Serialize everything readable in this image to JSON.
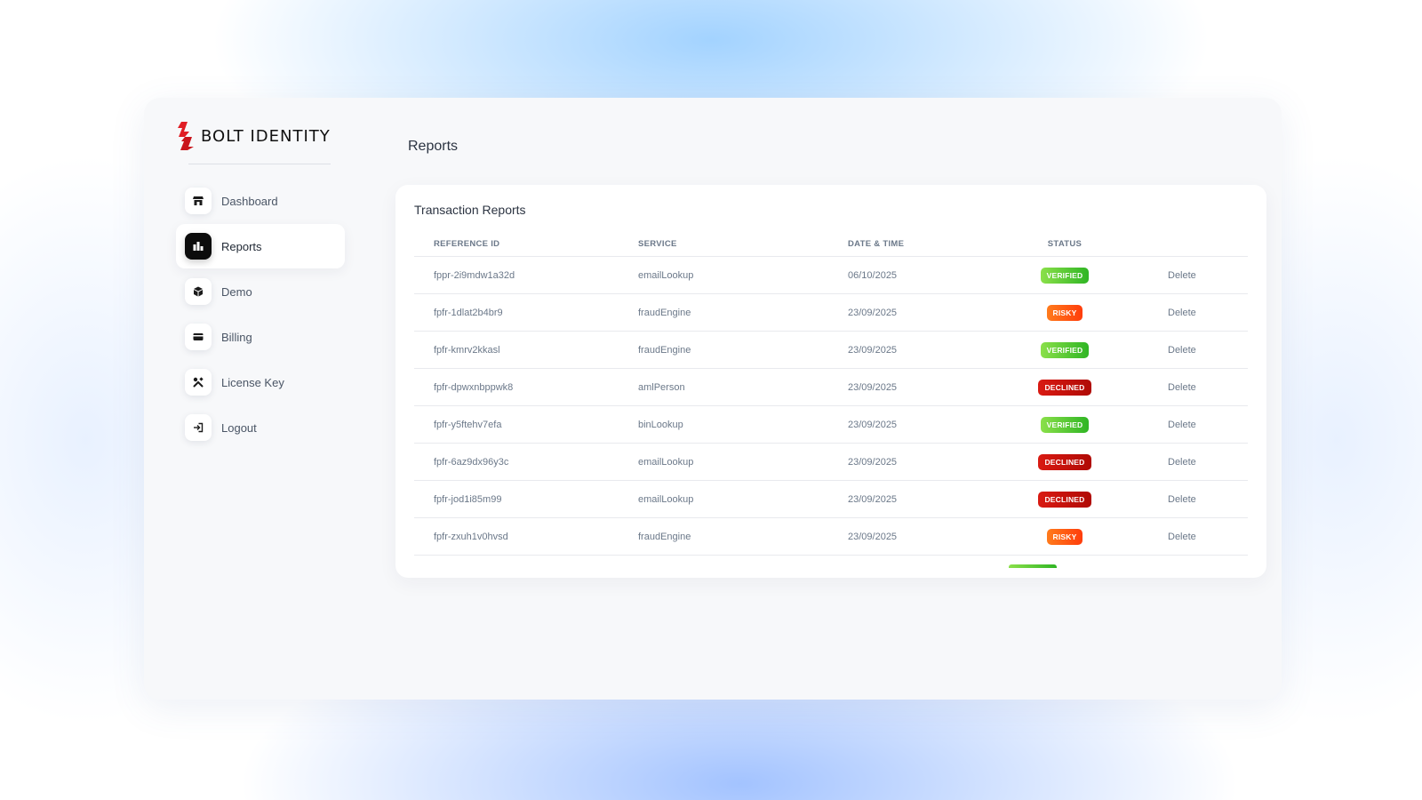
{
  "brand": {
    "name": "BOLT IDENTITY",
    "mark_color": "#e01e25"
  },
  "sidebar": {
    "items": [
      {
        "label": "Dashboard",
        "icon": "store-icon",
        "active": false
      },
      {
        "label": "Reports",
        "icon": "bar-chart-icon",
        "active": true
      },
      {
        "label": "Demo",
        "icon": "cube-icon",
        "active": false
      },
      {
        "label": "Billing",
        "icon": "credit-card-icon",
        "active": false
      },
      {
        "label": "License Key",
        "icon": "tools-icon",
        "active": false
      },
      {
        "label": "Logout",
        "icon": "logout-icon",
        "active": false
      }
    ]
  },
  "page": {
    "title": "Reports"
  },
  "reports": {
    "title": "Transaction Reports",
    "columns": [
      "REFERENCE ID",
      "SERVICE",
      "DATE & TIME",
      "STATUS",
      ""
    ],
    "rows": [
      {
        "ref": "fppr-2i9mdw1a32d",
        "service": "emailLookup",
        "date": "06/10/2025",
        "status": "VERIFIED",
        "status_kind": "verified",
        "action": "Delete"
      },
      {
        "ref": "fpfr-1dlat2b4br9",
        "service": "fraudEngine",
        "date": "23/09/2025",
        "status": "RISKY",
        "status_kind": "risky",
        "action": "Delete"
      },
      {
        "ref": "fpfr-kmrv2kkasl",
        "service": "fraudEngine",
        "date": "23/09/2025",
        "status": "VERIFIED",
        "status_kind": "verified",
        "action": "Delete"
      },
      {
        "ref": "fpfr-dpwxnbppwk8",
        "service": "amlPerson",
        "date": "23/09/2025",
        "status": "DECLINED",
        "status_kind": "declined",
        "action": "Delete"
      },
      {
        "ref": "fpfr-y5ftehv7efa",
        "service": "binLookup",
        "date": "23/09/2025",
        "status": "VERIFIED",
        "status_kind": "verified",
        "action": "Delete"
      },
      {
        "ref": "fpfr-6az9dx96y3c",
        "service": "emailLookup",
        "date": "23/09/2025",
        "status": "DECLINED",
        "status_kind": "declined",
        "action": "Delete"
      },
      {
        "ref": "fpfr-jod1i85m99",
        "service": "emailLookup",
        "date": "23/09/2025",
        "status": "DECLINED",
        "status_kind": "declined",
        "action": "Delete"
      },
      {
        "ref": "fpfr-zxuh1v0hvsd",
        "service": "fraudEngine",
        "date": "23/09/2025",
        "status": "RISKY",
        "status_kind": "risky",
        "action": "Delete"
      }
    ]
  },
  "colors": {
    "verified": "#3cbf2a",
    "risky": "#ff4d10",
    "declined": "#c4110a",
    "active_nav_icon_bg": "#0c0c0c"
  }
}
